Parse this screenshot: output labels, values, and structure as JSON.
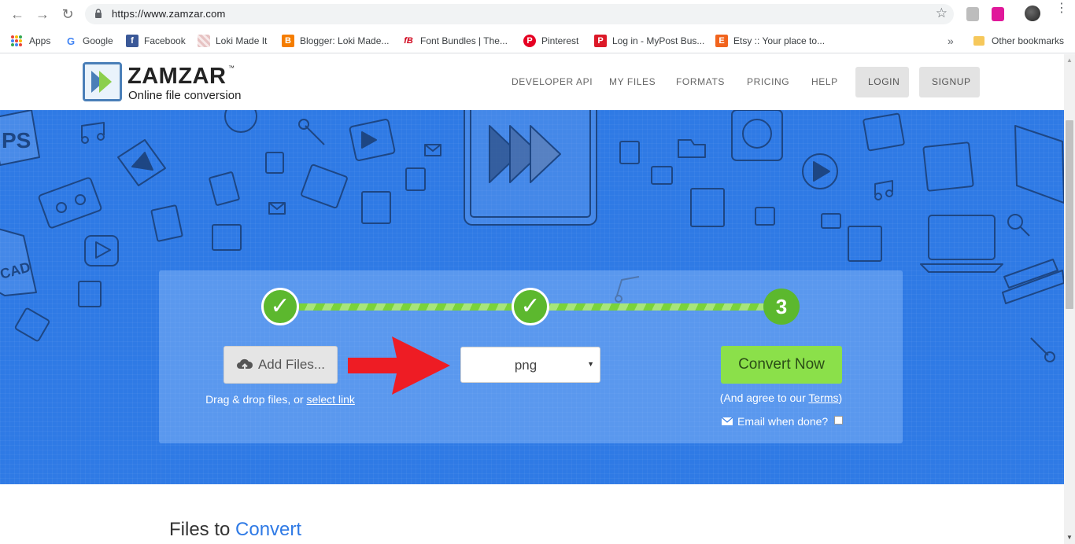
{
  "browser": {
    "url": "https://www.zamzar.com",
    "bookmarks": [
      {
        "label": "Apps"
      },
      {
        "label": "Google"
      },
      {
        "label": "Facebook"
      },
      {
        "label": "Loki Made It"
      },
      {
        "label": "Blogger: Loki Made..."
      },
      {
        "label": "Font Bundles | The..."
      },
      {
        "label": "Pinterest"
      },
      {
        "label": "Log in - MyPost Bus..."
      },
      {
        "label": "Etsy :: Your place to..."
      }
    ],
    "more_label": "»",
    "other_bookmarks": "Other bookmarks"
  },
  "header": {
    "logo_name": "ZAMZAR",
    "logo_tm": "™",
    "logo_tagline": "Online file conversion",
    "nav": [
      "DEVELOPER API",
      "MY FILES",
      "FORMATS",
      "PRICING",
      "HELP"
    ],
    "login": "LOGIN",
    "signup": "SIGNUP"
  },
  "converter": {
    "step1_mark": "✓",
    "step2_mark": "✓",
    "step3_number": "3",
    "add_files_label": "Add Files...",
    "drag_text": "Drag & drop files, or ",
    "select_link": "select link",
    "format_value": "png",
    "convert_label": "Convert Now",
    "agree_prefix": "(And agree to our ",
    "terms_link": "Terms",
    "agree_suffix": ")",
    "email_label": "Email when done?"
  },
  "files": {
    "title_prefix": "Files to ",
    "title_highlight": "Convert"
  },
  "colors": {
    "hero_blue": "#2f7ae5",
    "progress_green": "#7ad33a",
    "step_green": "#5cb82e",
    "convert_green": "#8be04a",
    "arrow_red": "#ee1c24"
  }
}
